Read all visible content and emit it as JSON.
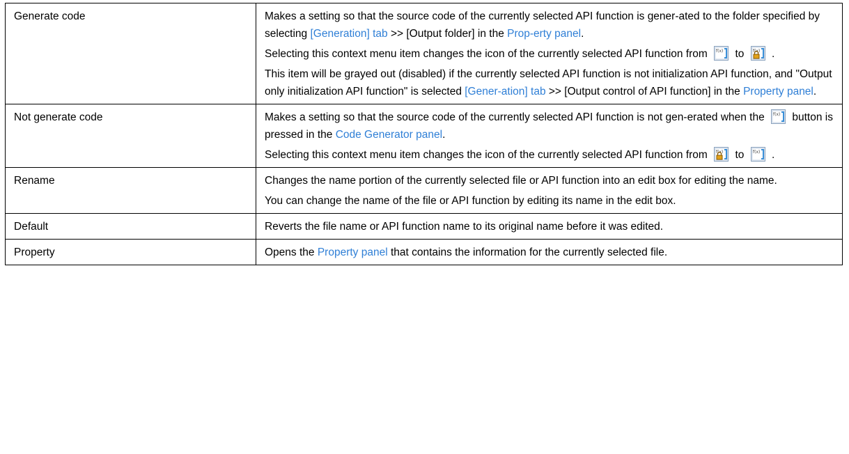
{
  "rows": [
    {
      "name": "Generate code",
      "p1": {
        "a": "Makes a setting so that the source code of the currently selected API function is gener-ated to the folder specified by selecting ",
        "link1": "[Generation] tab",
        "b": " >> [Output folder] in the ",
        "link2": "Prop-erty panel",
        "c": "."
      },
      "p2": {
        "a": "Selecting this context menu item changes the icon of the currently selected API function from ",
        "icon1": "api-function-icon",
        "mid": " to ",
        "icon2": "api-function-locked-icon",
        "end": " ."
      },
      "p3": {
        "a": "This item will be grayed out (disabled) if the currently selected API function is not initialization API function, and \"Output only initialization API function\" is selected ",
        "link1": "[Gener-ation] tab",
        "b": " >> [Output control of API function] in the ",
        "link2": "Property panel",
        "c": "."
      }
    },
    {
      "name": "Not generate code",
      "p1": {
        "a": "Makes a setting so that the source code of the currently selected API function is not gen-erated when the ",
        "icon": "generate-code-button-icon",
        "b": " button is pressed in the ",
        "link": "Code Generator panel",
        "c": "."
      },
      "p2": {
        "a": "Selecting this context menu item changes the icon of the currently selected API function from ",
        "icon1": "api-function-locked-icon",
        "mid": " to ",
        "icon2": "api-function-icon",
        "end": " ."
      }
    },
    {
      "name": "Rename",
      "p1": "Changes the name portion of the currently selected file or API function into an edit box for editing the name.",
      "p2": "You can change the name of the file or API function by editing its name in the edit box."
    },
    {
      "name": "Default",
      "p1": "Reverts the file name or API function name to its original name before it was edited."
    },
    {
      "name": "Property",
      "p1": {
        "a": "Opens the ",
        "link": "Property panel",
        "b": " that contains the information for the currently selected file."
      }
    }
  ],
  "colors": {
    "link": "#2f7fd6",
    "border": "#000000",
    "icon_blue": "#3a8fd8",
    "lock_gold": "#e3a21a"
  }
}
